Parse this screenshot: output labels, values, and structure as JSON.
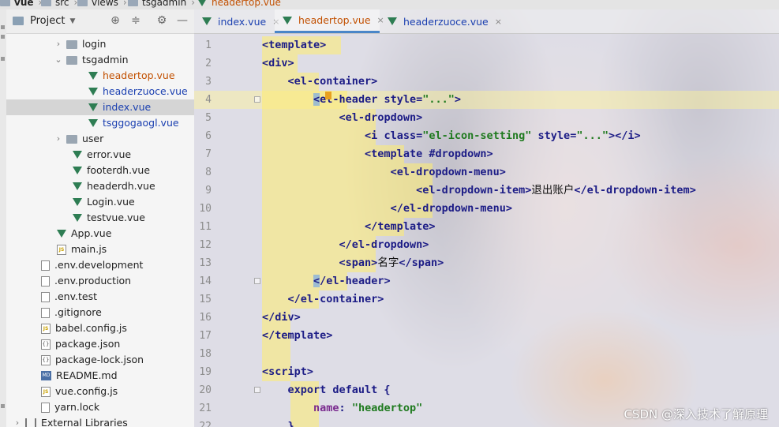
{
  "breadcrumb": {
    "items": [
      "vue",
      "src",
      "views",
      "tsgadmin",
      "headertop.vue"
    ]
  },
  "project": {
    "title": "Project"
  },
  "tree": [
    {
      "label": "login",
      "type": "folder",
      "expander": "›"
    },
    {
      "label": "tsgadmin",
      "type": "folder",
      "expander": "⌄"
    },
    {
      "label": "headertop.vue",
      "type": "vue"
    },
    {
      "label": "headerzuoce.vue",
      "type": "vue"
    },
    {
      "label": "index.vue",
      "type": "vue"
    },
    {
      "label": "tsggogaogl.vue",
      "type": "vue"
    },
    {
      "label": "user",
      "type": "folder",
      "expander": "›"
    },
    {
      "label": "error.vue",
      "type": "vue"
    },
    {
      "label": "footerdh.vue",
      "type": "vue"
    },
    {
      "label": "headerdh.vue",
      "type": "vue"
    },
    {
      "label": "Login.vue",
      "type": "vue"
    },
    {
      "label": "testvue.vue",
      "type": "vue"
    },
    {
      "label": "App.vue",
      "type": "vue"
    },
    {
      "label": "main.js",
      "type": "js"
    },
    {
      "label": ".env.development",
      "type": "file"
    },
    {
      "label": ".env.production",
      "type": "file"
    },
    {
      "label": ".env.test",
      "type": "file"
    },
    {
      "label": ".gitignore",
      "type": "file"
    },
    {
      "label": "babel.config.js",
      "type": "js"
    },
    {
      "label": "package.json",
      "type": "json"
    },
    {
      "label": "package-lock.json",
      "type": "json"
    },
    {
      "label": "README.md",
      "type": "md"
    },
    {
      "label": "vue.config.js",
      "type": "js"
    },
    {
      "label": "yarn.lock",
      "type": "file"
    },
    {
      "label": "External Libraries",
      "type": "lib",
      "expander": "›"
    }
  ],
  "tabs": [
    {
      "label": "index.vue",
      "close": "×"
    },
    {
      "label": "headertop.vue",
      "close": "×"
    },
    {
      "label": "headerzuoce.vue",
      "close": "×"
    }
  ],
  "line_numbers": [
    "1",
    "2",
    "3",
    "4",
    "5",
    "6",
    "7",
    "8",
    "9",
    "10",
    "11",
    "12",
    "13",
    "14",
    "15",
    "16",
    "17",
    "18",
    "19",
    "20",
    "21",
    "22"
  ],
  "code": {
    "l1": "<template>",
    "l2": "<div>",
    "l3": "<el-container>",
    "l4_tag": "el-header",
    "l4_attr": "style",
    "l4_val": "\"...\"",
    "l5": "<el-dropdown>",
    "l6_tag": "<i",
    "l6_attr1": "class",
    "l6_val1": "\"el-icon-setting\"",
    "l6_attr2": "style",
    "l6_val2": "\"...\"",
    "l6_close": "></i>",
    "l7_tag": "<template",
    "l7_slot": "#dropdown",
    "l8": "<el-dropdown-menu>",
    "l9_open": "<el-dropdown-item>",
    "l9_text": "退出账户",
    "l9_close": "</el-dropdown-item>",
    "l10": "</el-dropdown-menu>",
    "l11": "</template>",
    "l12": "</el-dropdown>",
    "l13_open": "<span>",
    "l13_text": "名字",
    "l13_close": "</span>",
    "l14": "/el-header>",
    "l15": "</el-container>",
    "l16": "</div>",
    "l17": "</template>",
    "l19": "<script>",
    "l20": "export default {",
    "l21_prop": "name",
    "l21_val": "\"headertop\"",
    "l22": "}"
  },
  "watermark": "CSDN @深入技术了解原理",
  "colors": {
    "modified_file": "#c25000",
    "open_file": "#1a3fb0",
    "vue_icon": "#2e7d53"
  }
}
